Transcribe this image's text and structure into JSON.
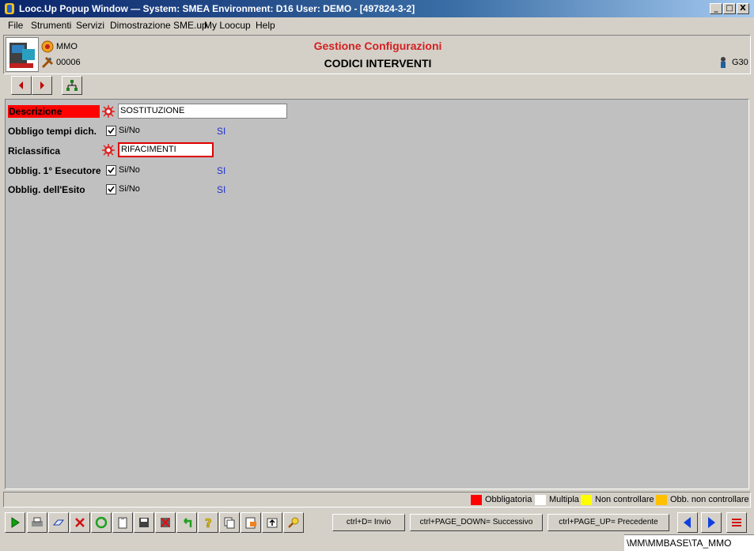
{
  "window": {
    "title": "Looc.Up Popup Window  —  System: SMEA Environment: D16 User: DEMO - [497824-3-2]",
    "buttons": [
      "_",
      "□",
      "X"
    ]
  },
  "menu": [
    "File",
    "Strumenti",
    "Servizi",
    "Dimostrazione SME.up",
    "My Loocup",
    "Help"
  ],
  "header": {
    "line1_code": "MMO",
    "line2_code": "00006",
    "title": "Gestione Configurazioni",
    "subtitle": "CODICI INTERVENTI",
    "user_code": "G30"
  },
  "form": {
    "fields": [
      {
        "label": "Descrizione",
        "value": "SOSTITUZIONE"
      },
      {
        "label": "Obbligo tempi dich.",
        "checkbox_label": "Si/No",
        "checked": true,
        "value": "SI"
      },
      {
        "label": "Riclassifica",
        "value": "RIFACIMENTI"
      },
      {
        "label": "Obblig. 1° Esecutore",
        "checkbox_label": "Si/No",
        "checked": true,
        "value": "SI"
      },
      {
        "label": "Obblig. dell'Esito",
        "checkbox_label": "Si/No",
        "checked": true,
        "value": "SI"
      }
    ]
  },
  "legend": [
    {
      "label": "Obbligatoria",
      "color": "#ff0000"
    },
    {
      "label": "Multipla",
      "color": "#ffffff"
    },
    {
      "label": "Non controllare",
      "color": "#ffff00"
    },
    {
      "label": "Obb. non controllare",
      "color": "#ffc000"
    }
  ],
  "shortcuts": {
    "invio": "ctrl+D= Invio",
    "successivo": "ctrl+PAGE_DOWN= Successivo",
    "precedente": "ctrl+PAGE_UP= Precedente"
  },
  "path": "\\MM\\MMBASE\\TA_MMO",
  "colors": {
    "required": "#ff0000",
    "title_red": "#d42020",
    "value_blue": "#1f2fcf"
  }
}
